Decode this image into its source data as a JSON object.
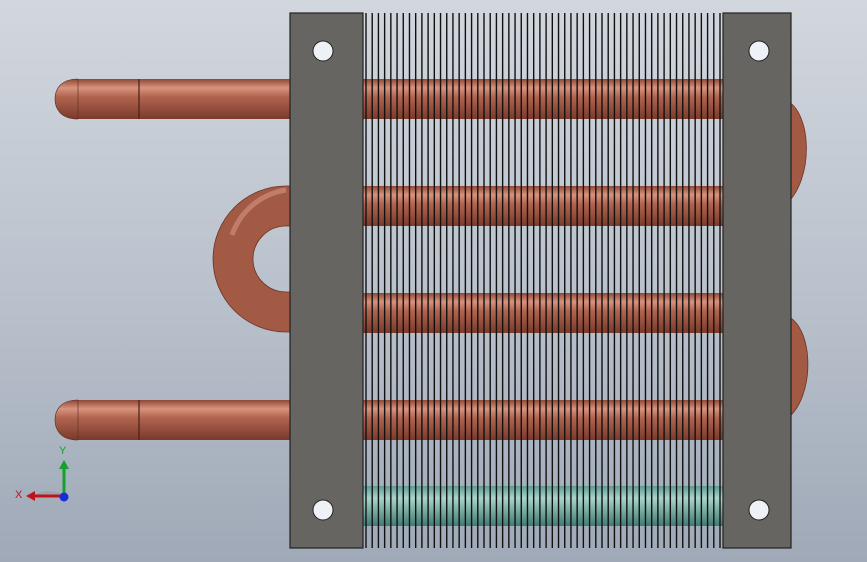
{
  "viewport": {
    "background_top": "#d2d7de",
    "background_bottom": "#9fa9b7"
  },
  "model": {
    "copper_color": "#a35a45",
    "copper_highlight": "#d99a86",
    "copper_shadow": "#7c3b2b",
    "plate_color": "#666561",
    "fin_color": "#111111",
    "fin_count": 58,
    "selected_tube_tint": "#6fa79d"
  },
  "triad": {
    "x_label": "X",
    "y_label": "Y",
    "x_color": "#c0141a",
    "y_color": "#16a02e",
    "z_color": "#1a2bd8"
  }
}
